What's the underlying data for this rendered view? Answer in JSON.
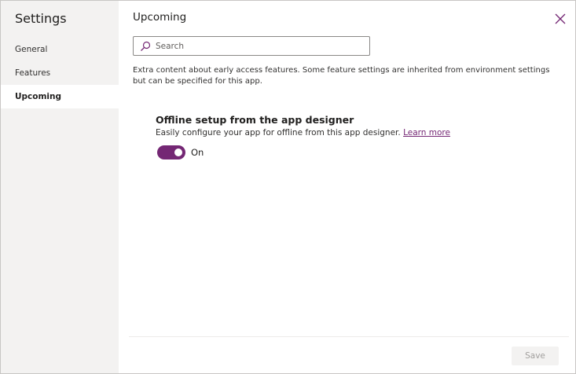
{
  "sidebar": {
    "title": "Settings",
    "items": [
      {
        "label": "General",
        "selected": false
      },
      {
        "label": "Features",
        "selected": false
      },
      {
        "label": "Upcoming",
        "selected": true
      }
    ]
  },
  "main": {
    "title": "Upcoming",
    "search": {
      "placeholder": "Search",
      "value": ""
    },
    "description": "Extra content about early access features. Some feature settings are inherited from environment settings but can be specified for this app.",
    "feature": {
      "title": "Offline setup from the app designer",
      "description": "Easily configure your app for offline from this app designer.",
      "link": "Learn more",
      "toggle_state": "On"
    },
    "save_label": "Save"
  },
  "colors": {
    "accent": "#742774",
    "sidebar_bg": "#f3f2f1"
  },
  "icons": {
    "close": "close-icon",
    "search": "search-icon"
  }
}
